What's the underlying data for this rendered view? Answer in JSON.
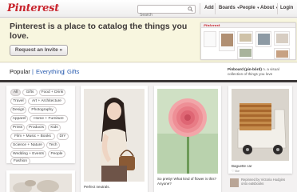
{
  "header": {
    "logo": "Pinterest",
    "search_placeholder": "Search",
    "nav": {
      "add": "Add",
      "boards": "Boards",
      "people": "People",
      "about": "About",
      "login": "Login"
    }
  },
  "banner": {
    "headline": "Pinterest is a place to catalog the things you love.",
    "invite_button": "Request an Invite »",
    "preview_logo": "Pinterest"
  },
  "categories": {
    "popular": "Popular",
    "everything": "Everything",
    "gifts": "Gifts",
    "separator": "|"
  },
  "tagline": {
    "title": "Pinboard (pin-bôrd)",
    "text": " n. a visual collection of things you love"
  },
  "category_tags": [
    "All",
    "Gifts",
    "Food + Drink",
    "Travel",
    "Art + Architecture",
    "Design",
    "Photography",
    "Apparel",
    "Home + Furniture",
    "Prints",
    "Products",
    "Kids",
    "Film + Music + Books",
    "DIY",
    "Science + Nature",
    "Tech",
    "Wedding + Events",
    "People",
    "Fashion"
  ],
  "pins": [
    {
      "caption": "Perfect neutrals.",
      "source": ""
    },
    {
      "caption": "So pretty! What kind of flower is this? Anyone?",
      "source": ""
    },
    {
      "caption": "Baguette car",
      "source": "♡ like"
    }
  ],
  "credit": {
    "line1": "Repinned by Victoria Hudgins",
    "line2": "onto eatsbooks"
  }
}
